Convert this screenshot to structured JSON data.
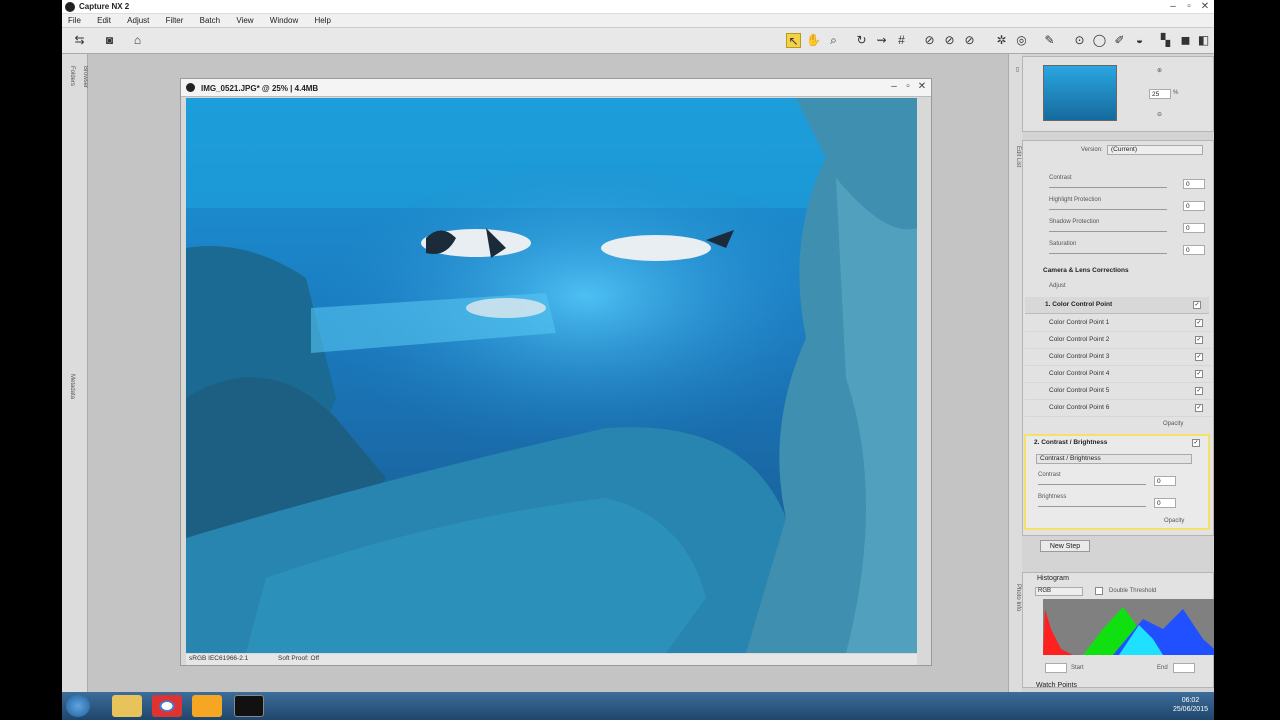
{
  "app": {
    "title": "Capture NX 2"
  },
  "menu": [
    "File",
    "Edit",
    "Adjust",
    "Filter",
    "Batch",
    "View",
    "Window",
    "Help"
  ],
  "left_tabs": [
    "Folders",
    "Browser",
    "Metadata"
  ],
  "document": {
    "title": "IMG_0521.JPG* @ 25% | 4.4MB",
    "color_profile": "sRGB IEC61966-2.1",
    "soft_proof": "Soft Proof: Off"
  },
  "bird_eye": {
    "zoom": "25",
    "unit": "%"
  },
  "edit_list": {
    "tab_label": "Edit List",
    "version_label": "Version:",
    "version_value": "(Current)",
    "top_sliders": [
      {
        "label": "Contrast",
        "value": "0"
      },
      {
        "label": "Highlight Protection",
        "value": "0"
      },
      {
        "label": "Shadow Protection",
        "value": "0"
      },
      {
        "label": "Saturation",
        "value": "0"
      }
    ],
    "camera_lens": "Camera & Lens Corrections",
    "adjust": "Adjust",
    "step1": "1. Color Control Point",
    "control_points": [
      "Color Control Point 1",
      "Color Control Point 2",
      "Color Control Point 3",
      "Color Control Point 4",
      "Color Control Point 5",
      "Color Control Point 6"
    ],
    "opacity": "Opacity",
    "step2": "2. Contrast / Brightness",
    "step2_select": "Contrast / Brightness",
    "contrast_label": "Contrast",
    "contrast_value": "0",
    "brightness_label": "Brightness",
    "brightness_value": "0",
    "new_step": "New Step"
  },
  "histogram": {
    "title": "Histogram",
    "channel": "RGB",
    "double_threshold": "Double Threshold",
    "start": "Start",
    "end": "End"
  },
  "watch_points": "Watch Points",
  "photo_info_tab": "Photo Info",
  "tray": {
    "time": "06:02",
    "date": "25/06/2015"
  },
  "colors": {
    "accent": "#f5e06a",
    "histogram_red": "#ff2020",
    "histogram_green": "#10e010",
    "histogram_blue": "#2050ff",
    "histogram_cyan": "#20e0ff"
  }
}
